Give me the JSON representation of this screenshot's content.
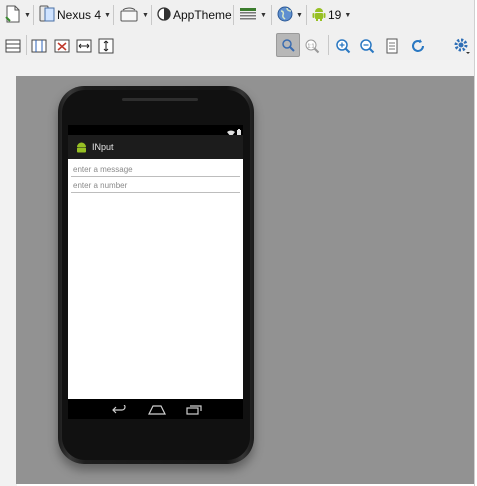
{
  "toolbar": {
    "device_label": "Nexus 4",
    "theme_label": "AppTheme",
    "api_label": "19"
  },
  "app": {
    "title": "INput"
  },
  "form": {
    "message_placeholder": "enter a message",
    "number_placeholder": "enter a number"
  },
  "colors": {
    "canvas_bg": "#929292",
    "toolbar_bg": "#f0f0f0",
    "android_green": "#97c024",
    "zoom_blue": "#2a78c2"
  },
  "icons": [
    "new-config-icon",
    "device-icon",
    "orientation-icon",
    "theme-icon",
    "activity-icon",
    "locale-icon",
    "android-icon",
    "list-icon",
    "columns-icon",
    "remove-icon",
    "horizontal-resize-icon",
    "vertical-resize-icon",
    "zoom-fit-icon",
    "zoom-actual-icon",
    "zoom-in-icon",
    "zoom-out-icon",
    "document-icon",
    "refresh-icon",
    "settings-icon"
  ]
}
